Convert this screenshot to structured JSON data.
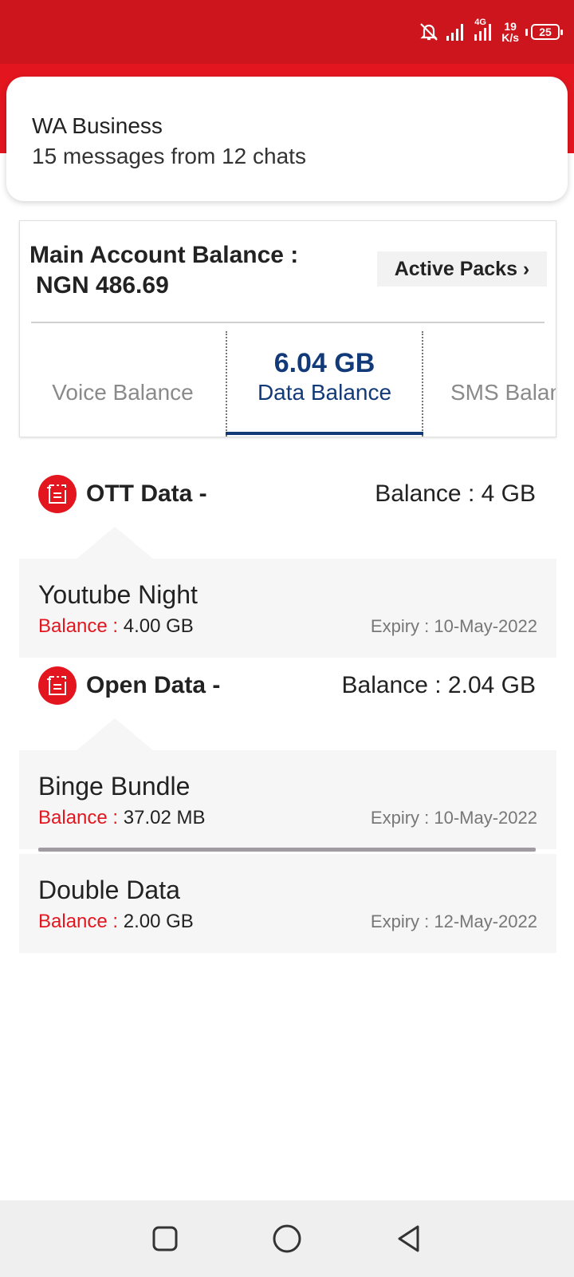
{
  "status_bar": {
    "network_type": "4G",
    "net_speed_value": "19",
    "net_speed_unit": "K/s",
    "battery_level": "25",
    "bar_color": "#cc151c"
  },
  "notification": {
    "app_name": "WA Business",
    "message": "15 messages from 12 chats"
  },
  "account": {
    "main_balance_label": "Main Account Balance :",
    "main_balance_value": "NGN 486.69",
    "active_packs_label": "Active Packs ›"
  },
  "tabs": [
    {
      "label": "Voice Balance",
      "value": "",
      "active": false
    },
    {
      "label": "Data Balance",
      "value": "6.04 GB",
      "active": true
    },
    {
      "label": "SMS Balance",
      "value": "",
      "active": false
    }
  ],
  "sections": [
    {
      "title": "OTT Data -",
      "balance": "Balance : 4 GB",
      "icon": "data-pack-icon",
      "packs": [
        {
          "name": "Youtube Night",
          "balance_label": "Balance :",
          "balance_value": "4.00 GB",
          "expiry": "Expiry : 10-May-2022"
        }
      ]
    },
    {
      "title": "Open Data -",
      "balance": "Balance : 2.04 GB",
      "icon": "data-pack-icon",
      "packs": [
        {
          "name": "Binge Bundle",
          "balance_label": "Balance :",
          "balance_value": "37.02 MB",
          "expiry": "Expiry : 10-May-2022"
        },
        {
          "name": "Double Data",
          "balance_label": "Balance :",
          "balance_value": "2.00 GB",
          "expiry": "Expiry : 12-May-2022"
        }
      ]
    }
  ],
  "nav": {
    "recents_icon": "square-icon",
    "home_icon": "circle-icon",
    "back_icon": "triangle-back-icon"
  },
  "colors": {
    "brand_red": "#e3161f",
    "accent_blue": "#123a78",
    "pack_background": "#f6f6f6"
  }
}
